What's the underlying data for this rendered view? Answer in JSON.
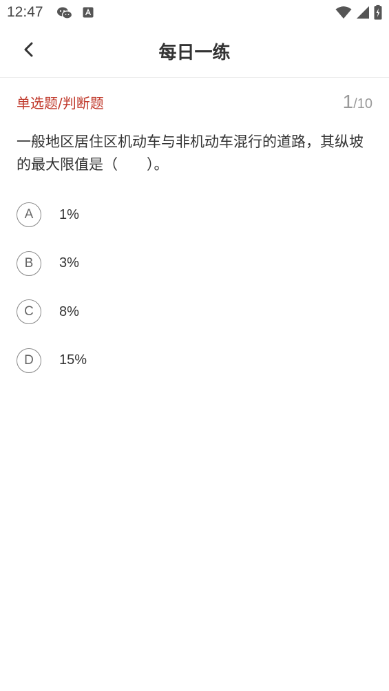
{
  "status_bar": {
    "time": "12:47",
    "icons": [
      "wechat-icon",
      "a-notification-icon",
      "wifi-icon",
      "signal-icon",
      "battery-icon"
    ]
  },
  "header": {
    "title": "每日一练",
    "back_icon": "chevron-left-icon"
  },
  "question": {
    "type_label": "单选题/判断题",
    "current": "1",
    "total": "/10",
    "text": "一般地区居住区机动车与非机动车混行的道路，其纵坡的最大限值是（　　）。",
    "options": [
      {
        "letter": "A",
        "text": "1%"
      },
      {
        "letter": "B",
        "text": "3%"
      },
      {
        "letter": "C",
        "text": "8%"
      },
      {
        "letter": "D",
        "text": "15%"
      }
    ]
  },
  "colors": {
    "accent_red": "#c0392b",
    "text": "#333333",
    "muted": "#999999"
  }
}
